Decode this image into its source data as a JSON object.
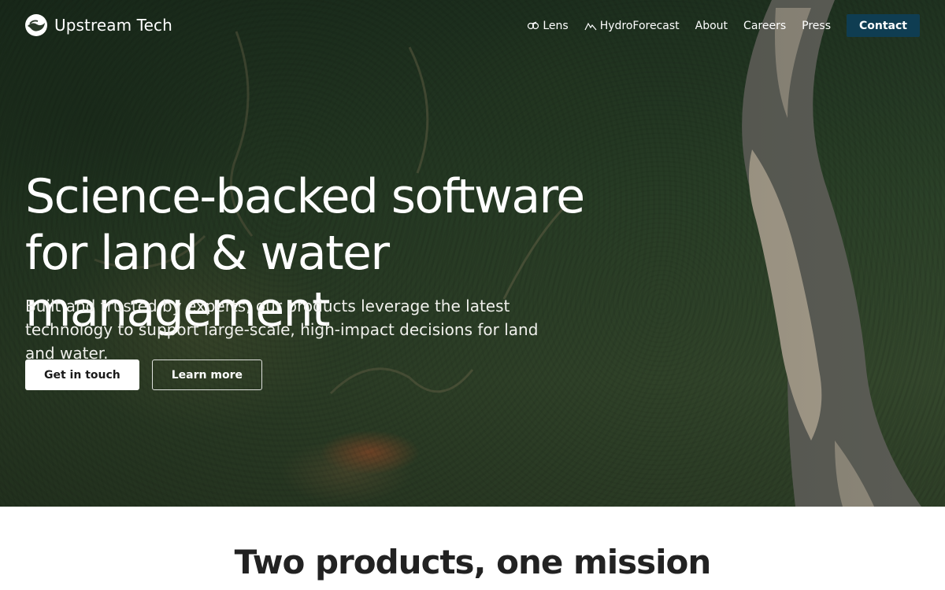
{
  "brand": {
    "name": "Upstream Tech",
    "logo_icon": "upstream-logo-icon"
  },
  "nav": {
    "items": [
      {
        "label": "Lens",
        "icon": "lens-icon"
      },
      {
        "label": "HydroForecast",
        "icon": "hydrograph-icon"
      },
      {
        "label": "About"
      },
      {
        "label": "Careers"
      },
      {
        "label": "Press"
      }
    ],
    "contact_label": "Contact"
  },
  "hero": {
    "title": "Science-backed software for land & water management",
    "subtitle": "Built and trusted by experts, our products leverage the latest technology to support large-scale, high-impact decisions for land and water.",
    "primary_cta": "Get in touch",
    "secondary_cta": "Learn more"
  },
  "section": {
    "title": "Two products, one mission"
  },
  "colors": {
    "contact_button": "#0f3d52",
    "forest": "#2b4128",
    "river_sand": "#9c9484",
    "section_text": "#222222"
  }
}
